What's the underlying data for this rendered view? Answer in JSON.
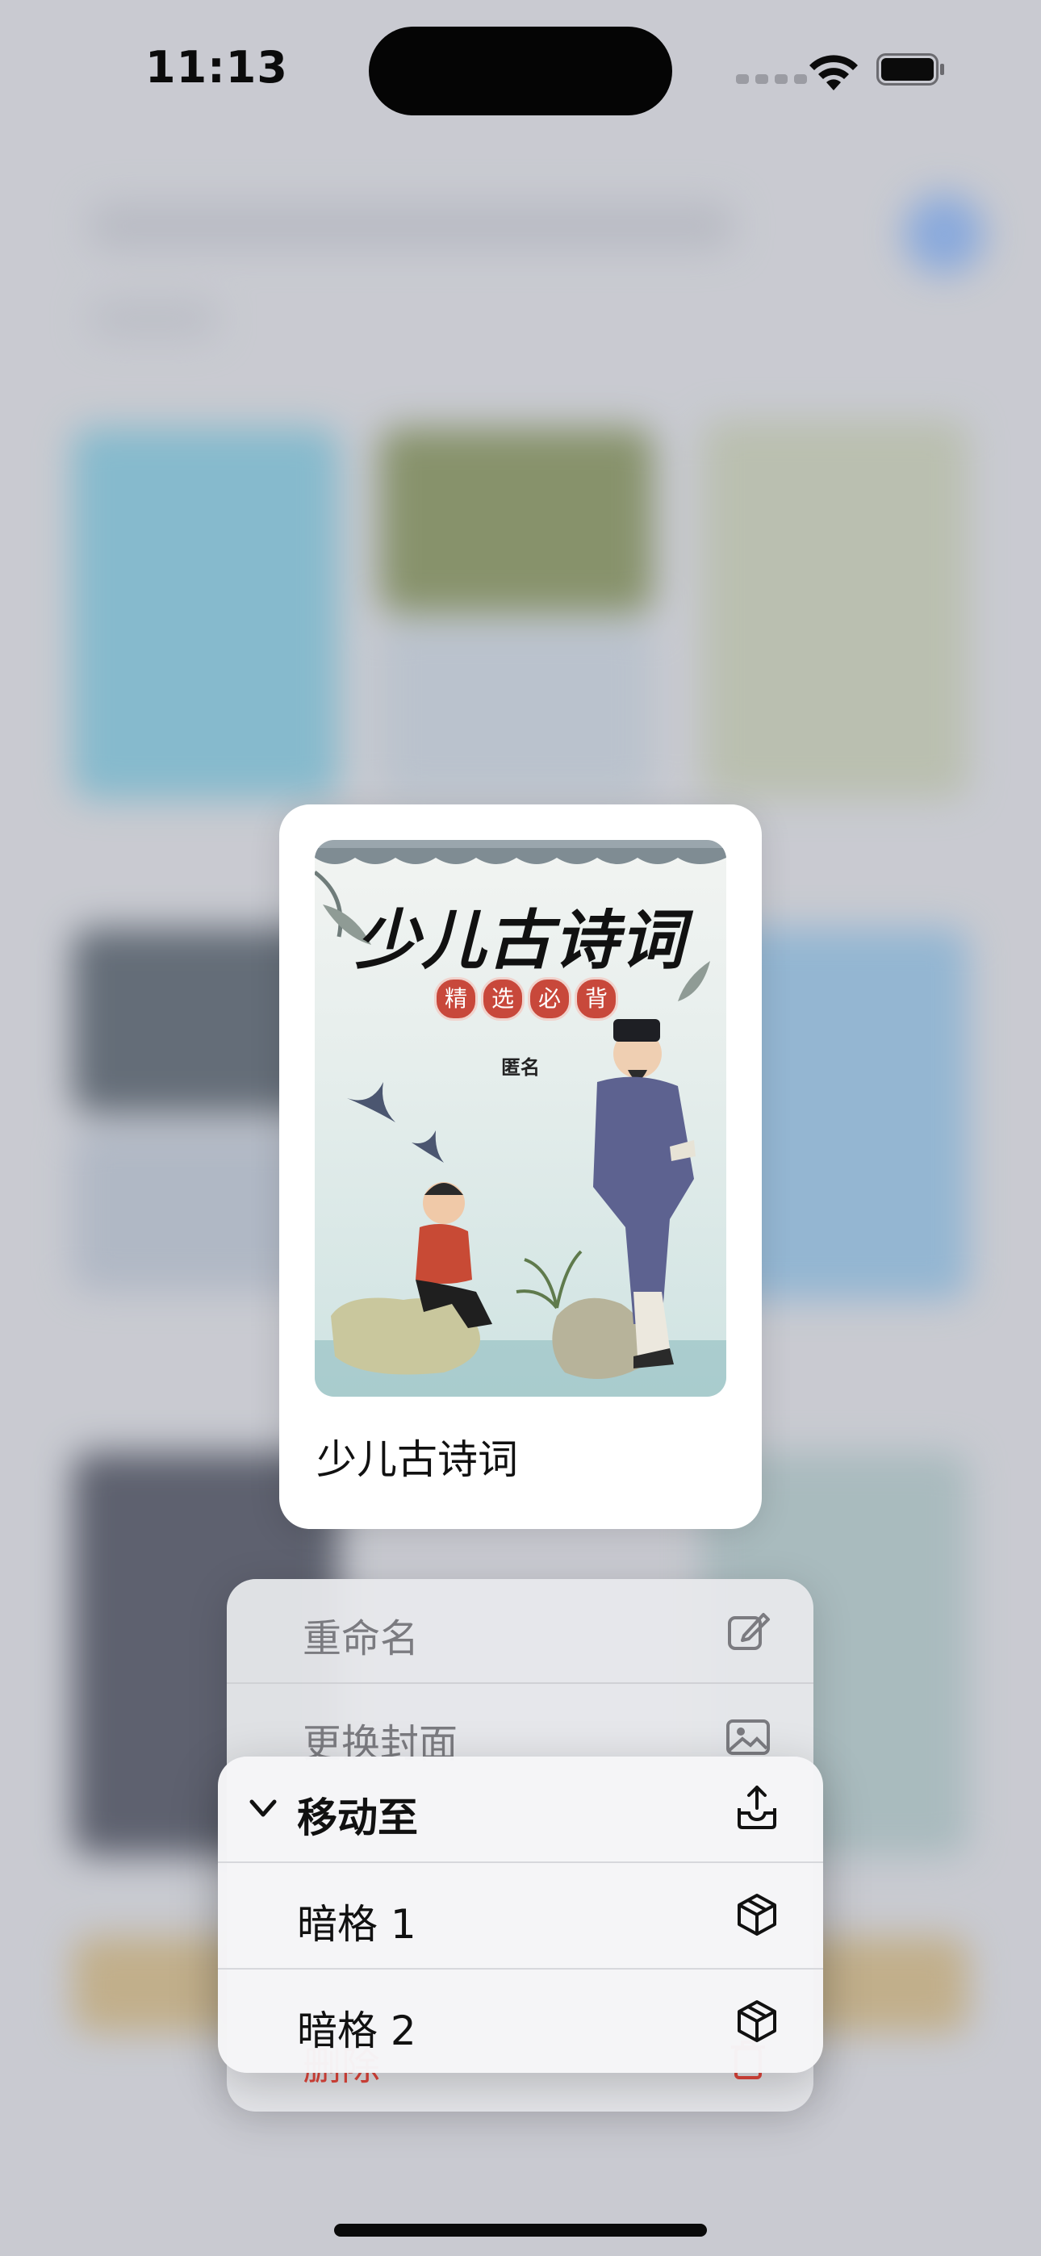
{
  "status_bar": {
    "time": "11:13",
    "signal_icon": "cellular-signal-icon",
    "wifi_icon": "wifi-icon",
    "battery_icon": "battery-icon"
  },
  "book": {
    "cover_title": "少儿古诗词",
    "cover_subtitle": [
      "精",
      "选",
      "必",
      "背"
    ],
    "cover_author": "匿名",
    "title": "少儿古诗词"
  },
  "context_menu": {
    "items": [
      {
        "label": "重命名",
        "icon": "edit-icon"
      },
      {
        "label": "更换封面",
        "icon": "image-icon"
      },
      {
        "label": "删除",
        "icon": "trash-icon"
      }
    ]
  },
  "submenu": {
    "header": {
      "label": "移动至",
      "icon": "move-out-icon",
      "expanded_icon": "chevron-down-icon"
    },
    "items": [
      {
        "label": "暗格 1",
        "icon": "cube-icon"
      },
      {
        "label": "暗格 2",
        "icon": "cube-icon"
      }
    ]
  },
  "colors": {
    "accent_blue": "#6f9ee6",
    "danger_red": "#e2463c",
    "cover_badge": "#c8483b"
  }
}
